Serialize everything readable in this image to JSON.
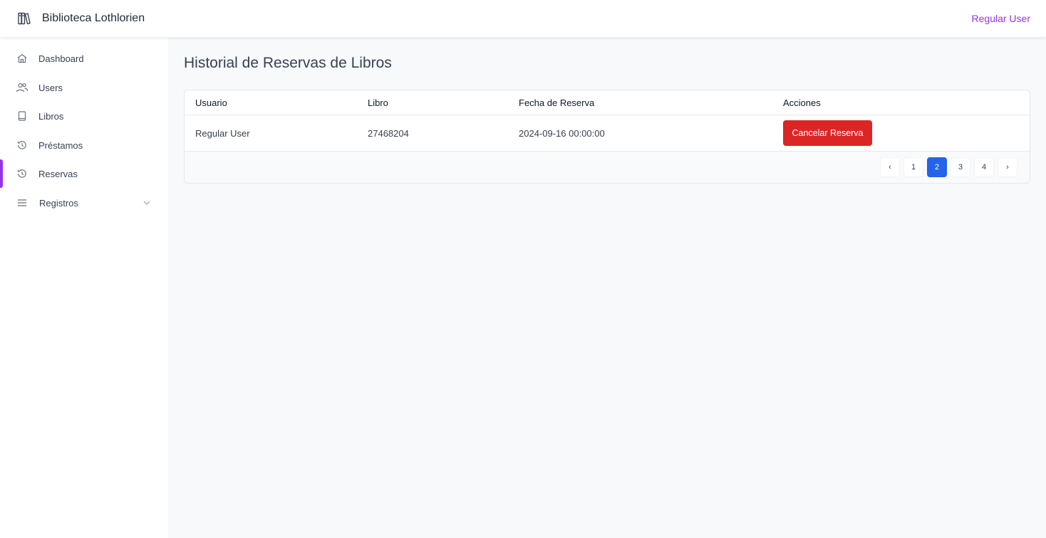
{
  "header": {
    "brand_icon": "books-icon",
    "brand_title": "Biblioteca Lothlorien",
    "user_label": "Regular User"
  },
  "sidebar": {
    "items": [
      {
        "label": "Dashboard",
        "icon": "home-icon"
      },
      {
        "label": "Users",
        "icon": "users-icon"
      },
      {
        "label": "Libros",
        "icon": "book-icon"
      },
      {
        "label": "Préstamos",
        "icon": "history-icon"
      },
      {
        "label": "Reservas",
        "icon": "history-icon",
        "active": true
      },
      {
        "label": "Registros",
        "icon": "menu-icon",
        "expandable": true
      }
    ]
  },
  "main": {
    "title": "Historial de Reservas de Libros",
    "table": {
      "columns": [
        "Usuario",
        "Libro",
        "Fecha de Reserva",
        "Acciones"
      ],
      "rows": [
        {
          "usuario": "Regular User",
          "libro": "27468204",
          "fecha": "2024-09-16 00:00:00",
          "action_label": "Cancelar Reserva"
        }
      ]
    },
    "pagination": {
      "prev": "‹",
      "pages": [
        "1",
        "2",
        "3",
        "4"
      ],
      "current": "2",
      "next": "›"
    }
  },
  "colors": {
    "accent": "#9333ea",
    "danger": "#dc2626",
    "primary": "#2563eb"
  }
}
